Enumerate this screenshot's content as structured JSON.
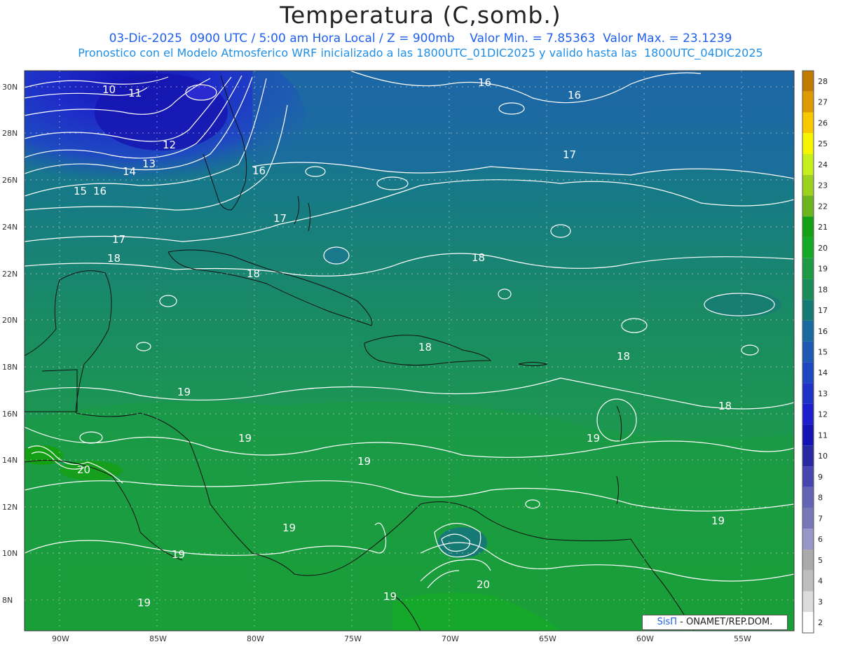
{
  "header": {
    "title": "Temperatura (C,somb.)",
    "line1": "03-Dic-2025  0900 UTC / 5:00 am Hora Local / Z = 900mb    Valor Min. = 7.85363  Valor Max. = 23.1239",
    "line2": "Pronostico con el Modelo Atmosferico WRF inicializado a las 1800UTC_01DIC2025 y valido hasta las  1800UTC_04DIC2025"
  },
  "map": {
    "lon_labels": [
      "90W",
      "85W",
      "80W",
      "75W",
      "70W",
      "65W",
      "60W",
      "55W"
    ],
    "lat_labels": [
      "30N",
      "28N",
      "26N",
      "24N",
      "22N",
      "20N",
      "18N",
      "16N",
      "14N",
      "12N",
      "10N",
      "8N"
    ],
    "contour_labels": [
      "10",
      "11",
      "12",
      "13",
      "14",
      "15",
      "16",
      "16",
      "16",
      "16",
      "17",
      "17",
      "17",
      "18",
      "18",
      "18",
      "18",
      "18",
      "19",
      "19",
      "19",
      "19",
      "19",
      "19",
      "19",
      "19",
      "20",
      "20"
    ]
  },
  "colorbar": {
    "levels": [
      "28",
      "27",
      "26",
      "25",
      "24",
      "23",
      "22",
      "21",
      "20",
      "19",
      "18",
      "17",
      "16",
      "15",
      "14",
      "13",
      "12",
      "11",
      "10",
      "9",
      "8",
      "7",
      "6",
      "5",
      "4",
      "3",
      "2"
    ],
    "colors": [
      "#c07a00",
      "#de9a00",
      "#f8c800",
      "#f5f500",
      "#c8ee1e",
      "#9cd21e",
      "#6eb41e",
      "#14a014",
      "#14aa28",
      "#1e9a46",
      "#1a8c5a",
      "#167a74",
      "#186aa0",
      "#1e5ab4",
      "#1e46c0",
      "#1e32c8",
      "#1e1ecc",
      "#1414b4",
      "#2828a0",
      "#4646b0",
      "#6464b4",
      "#7878b8",
      "#9696c8",
      "#aaaaaa",
      "#bebebe",
      "#dcdcdc",
      "#ffffff"
    ]
  },
  "credit": {
    "logo": "SisΠ",
    "text": "- ONAMET/REP.DOM."
  }
}
